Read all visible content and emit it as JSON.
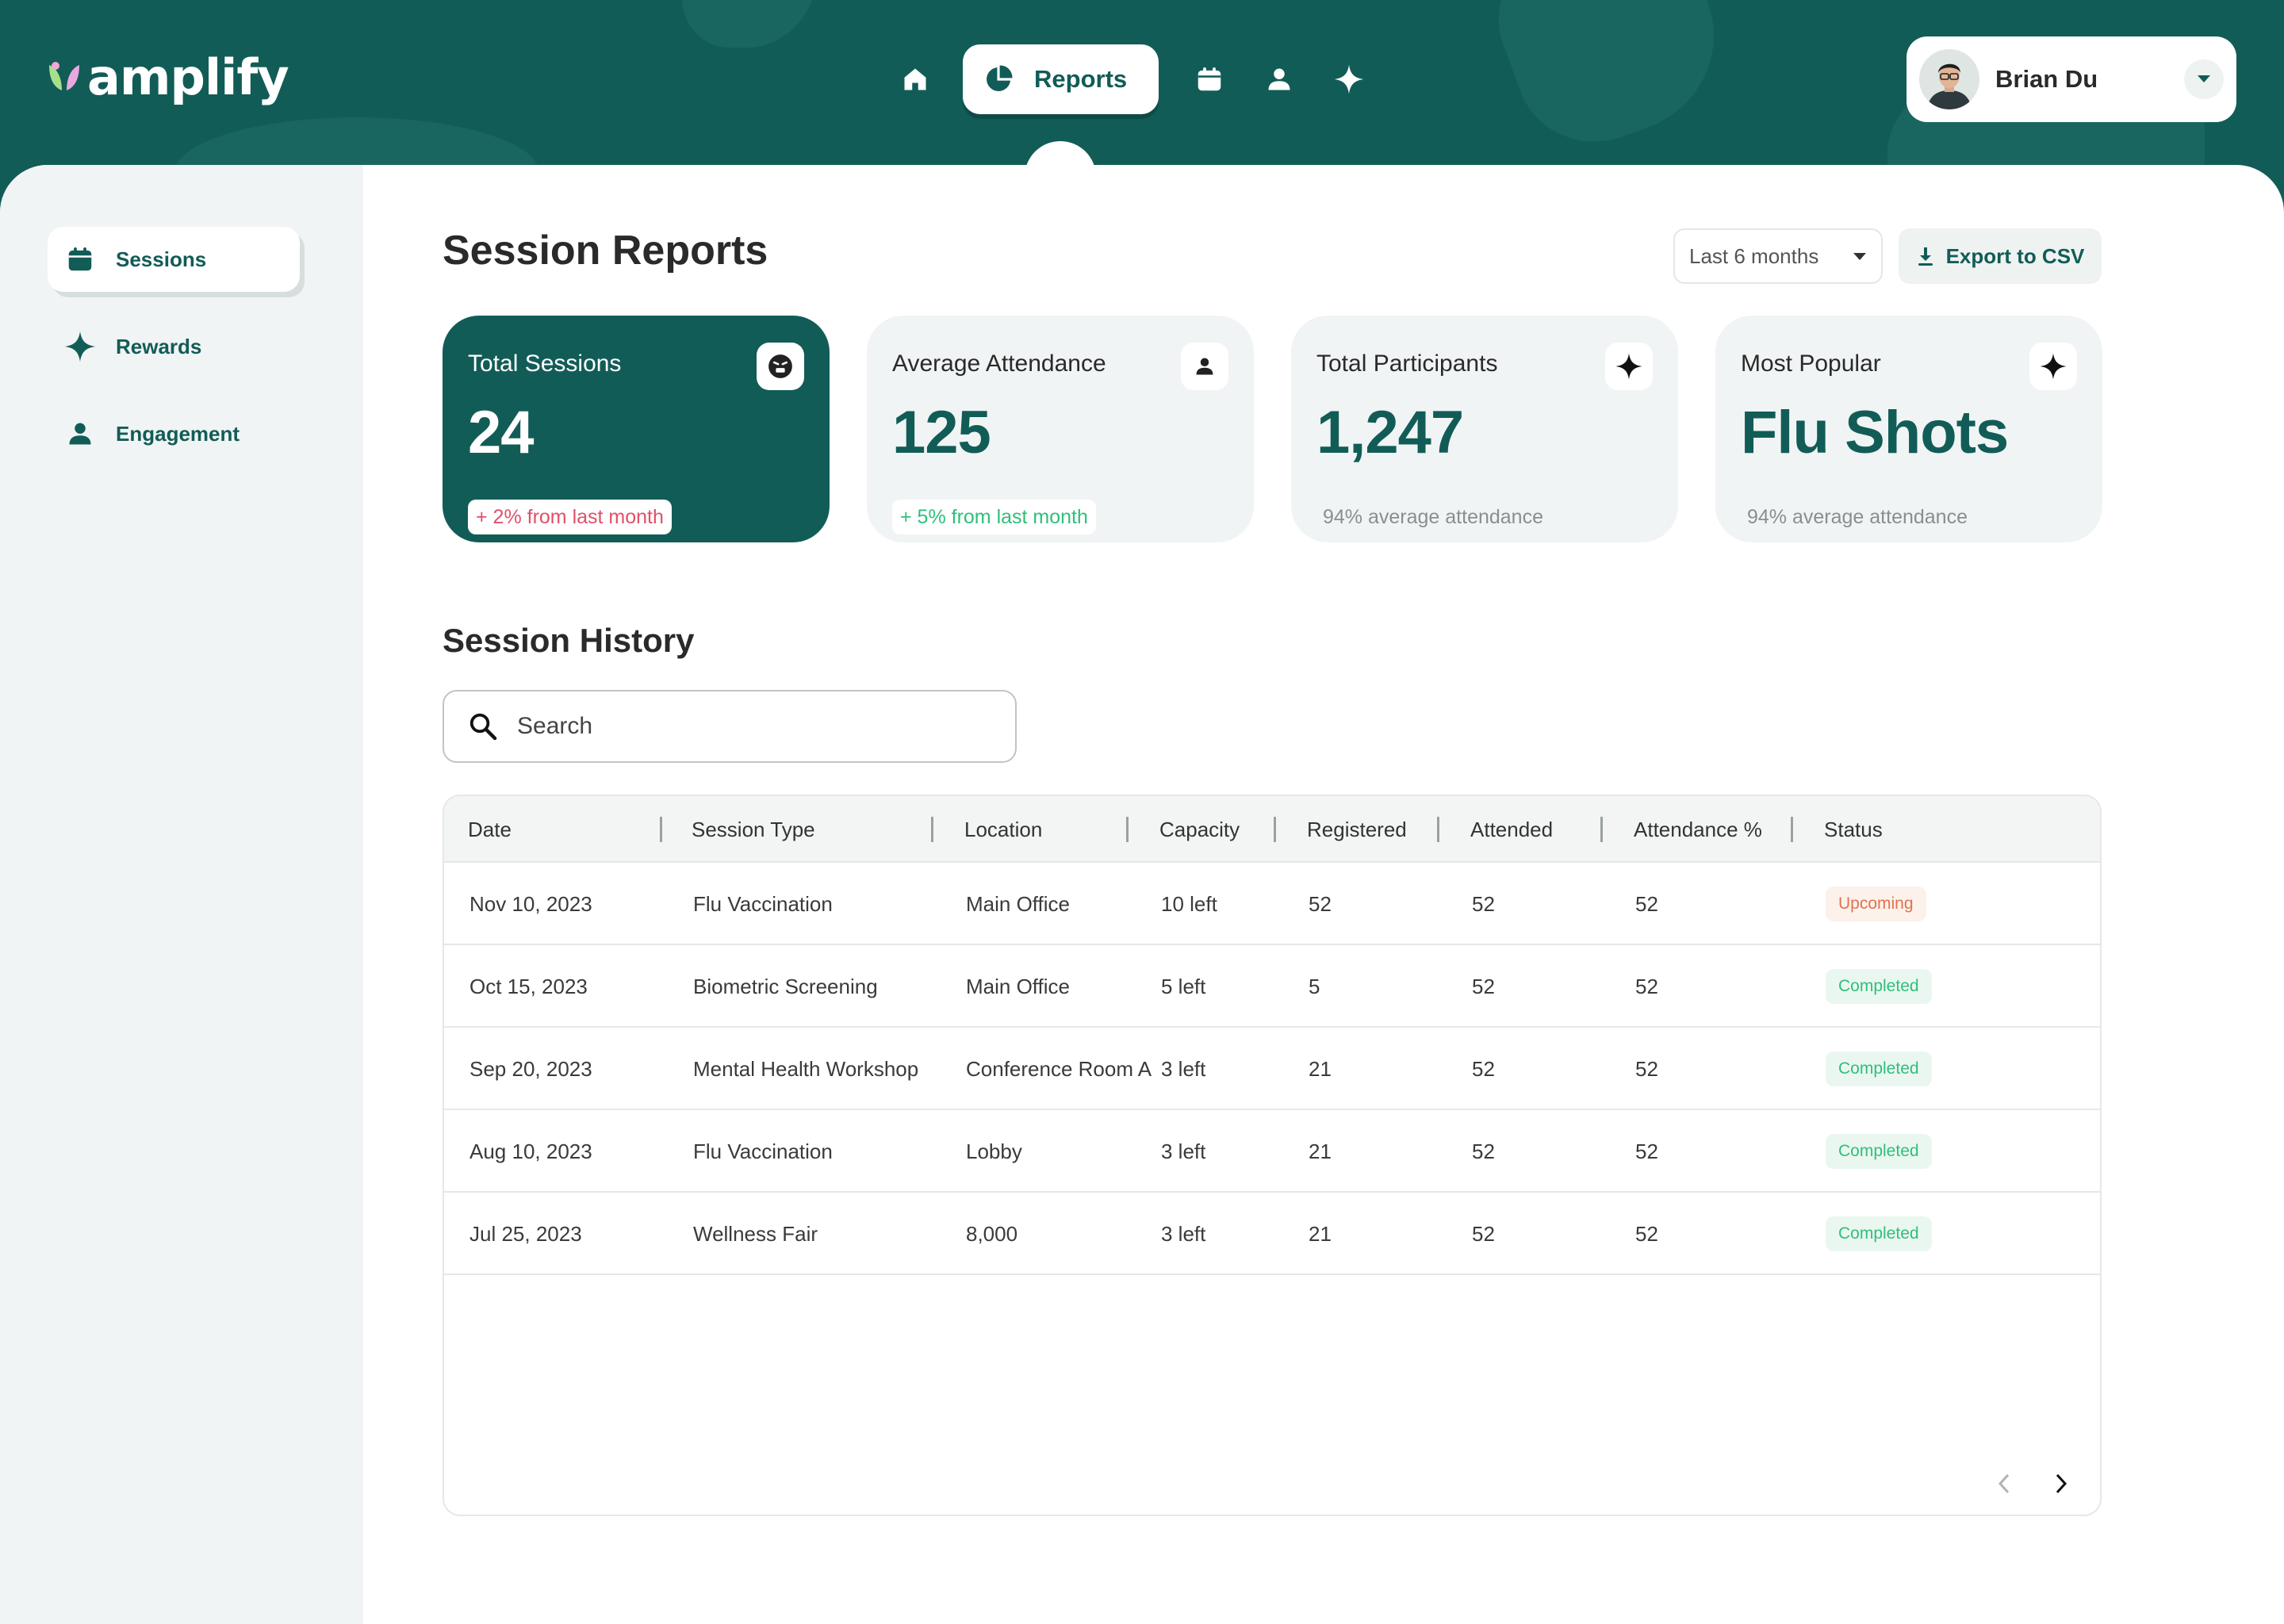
{
  "brand": {
    "name": "amplify"
  },
  "nav": {
    "items": [
      {
        "icon": "home-icon"
      },
      {
        "icon": "pie-chart-icon",
        "label": "Reports",
        "active": true
      },
      {
        "icon": "calendar-icon"
      },
      {
        "icon": "user-icon"
      },
      {
        "icon": "sparkle-icon"
      }
    ]
  },
  "user": {
    "name": "Brian Du"
  },
  "sidebar": {
    "items": [
      {
        "label": "Sessions",
        "icon": "calendar-icon",
        "active": true
      },
      {
        "label": "Rewards",
        "icon": "sparkle-icon"
      },
      {
        "label": "Engagement",
        "icon": "user-icon"
      }
    ]
  },
  "page": {
    "title": "Session Reports",
    "range": "Last 6 months",
    "export_label": "Export to CSV"
  },
  "stats": [
    {
      "title": "Total Sessions",
      "value": "24",
      "badge": "+ 2% from last month",
      "icon": "emoji-icon"
    },
    {
      "title": "Average Attendance",
      "value": "125",
      "badge": "+ 5% from last month",
      "icon": "user-icon"
    },
    {
      "title": "Total Participants",
      "value": "1,247",
      "sub": "94% average attendance",
      "icon": "sparkle-icon"
    },
    {
      "title": "Most Popular",
      "value": "Flu Shots",
      "sub": "94% average attendance",
      "icon": "sparkle-icon"
    }
  ],
  "history": {
    "title": "Session History",
    "search_placeholder": "Search",
    "columns": [
      "Date",
      "Session Type",
      "Location",
      "Capacity",
      "Registered",
      "Attended",
      "Attendance %",
      "Status"
    ],
    "rows": [
      [
        "Nov 10, 2023",
        "Flu Vaccination",
        "Main Office",
        "10 left",
        "52",
        "52",
        "52",
        "Upcoming"
      ],
      [
        "Oct 15, 2023",
        "Biometric Screening",
        "Main Office",
        "5 left",
        "5",
        "52",
        "52",
        "Completed"
      ],
      [
        "Sep 20, 2023",
        "Mental Health Workshop",
        "Conference Room A",
        "3 left",
        "21",
        "52",
        "52",
        "Completed"
      ],
      [
        "Aug 10, 2023",
        "Flu Vaccination",
        "Lobby",
        "3 left",
        "21",
        "52",
        "52",
        "Completed"
      ],
      [
        "Jul 25, 2023",
        "Wellness Fair",
        "8,000",
        "3 left",
        "21",
        "52",
        "52",
        "Completed"
      ]
    ]
  },
  "colors": {
    "brand": "#125c57",
    "positive": "#2fbf7b",
    "negative": "#e0506a",
    "upcoming": "#e0734e"
  }
}
